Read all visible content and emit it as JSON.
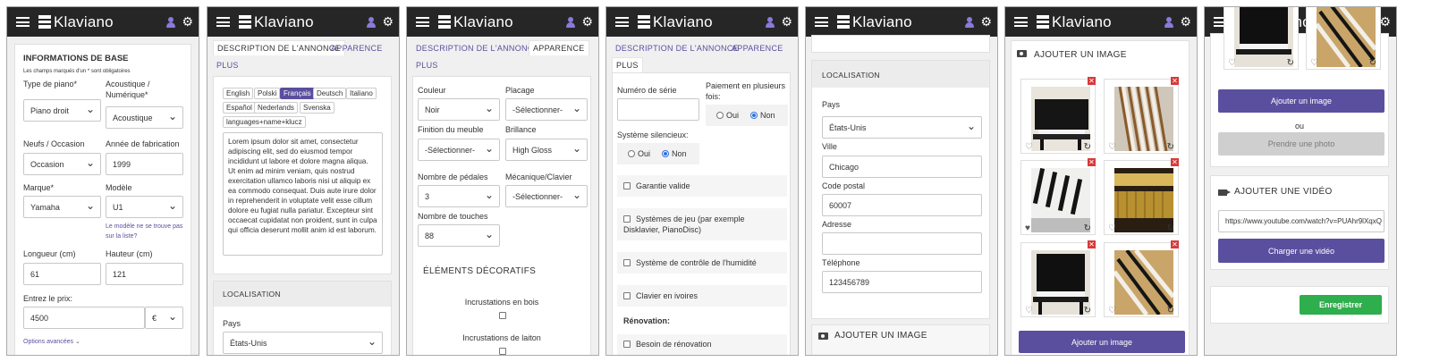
{
  "app": {
    "name": "Klaviano"
  },
  "panel1": {
    "title": "INFORMATIONS DE BASE",
    "note": "Les champs marqués d'un * sont obligatoires",
    "piano_type_label": "Type de piano*",
    "piano_type_value": "Piano droit",
    "acoustic_label": "Acoustique / Numérique*",
    "acoustic_value": "Acoustique",
    "condition_label": "Neufs / Occasion",
    "condition_value": "Occasion",
    "year_label": "Année de fabrication",
    "year_value": "1999",
    "brand_label": "Marque*",
    "brand_value": "Yamaha",
    "model_label": "Modèle",
    "model_value": "U1",
    "model_missing": "Le modèle ne se trouve pas sur la liste?",
    "length_label": "Longueur (cm)",
    "length_value": "61",
    "height_label": "Hauteur (cm)",
    "height_value": "121",
    "price_label": "Entrez le prix:",
    "price_value": "4500",
    "currency": "€",
    "advanced": "Options avancées ⌄"
  },
  "panel2": {
    "tab_description": "DESCRIPTION DE L'ANNONCE",
    "tab_appearance": "APPARENCE",
    "tab_more": "PLUS",
    "languages": [
      "English",
      "Polski",
      "Français",
      "Deutsch",
      "Italiano",
      "Español",
      "Nederlands",
      "Svenska",
      "languages+name+klucz"
    ],
    "selected_language": "Français",
    "lorem": "Lorem ipsum dolor sit amet, consectetur adipiscing elit, sed do eiusmod tempor incididunt ut labore et dolore magna aliqua. Ut enim ad minim veniam, quis nostrud exercitation ullamco laboris nisi ut aliquip ex ea commodo consequat. Duis aute irure dolor in reprehenderit in voluptate velit esse cillum dolore eu fugiat nulla pariatur. Excepteur sint occaecat cupidatat non proident, sunt in culpa qui officia deserunt mollit anim id est laborum.",
    "location_title": "LOCALISATION",
    "country_label": "Pays",
    "country_value": "États-Unis"
  },
  "panel3": {
    "tab_description": "DESCRIPTION DE L'ANNONCE",
    "tab_appearance": "APPARENCE",
    "tab_more": "PLUS",
    "color_label": "Couleur",
    "color_value": "Noir",
    "placement_label": "Placage",
    "placement_value": "-Sélectionner-",
    "finish_label": "Finition du meuble",
    "finish_value": "-Sélectionner-",
    "gloss_label": "Brillance",
    "gloss_value": "High Gloss",
    "pedals_label": "Nombre de pédales",
    "pedals_value": "3",
    "mechanics_label": "Mécanique/Clavier",
    "mechanics_value": "-Sélectionner-",
    "keys_label": "Nombre de touches",
    "keys_value": "88",
    "decor_title": "ÉLÉMENTS DÉCORATIFS",
    "inlay_wood": "Incrustations en bois",
    "inlay_brass": "Incrustations de laiton"
  },
  "panel4": {
    "tab_description": "DESCRIPTION DE L'ANNONCE",
    "tab_appearance": "APPARENCE",
    "tab_more": "PLUS",
    "serial_label": "Numéro de série",
    "installments_label": "Paiement en plusieurs fois:",
    "yes": "Oui",
    "no": "Non",
    "silent_label": "Système silencieux:",
    "warranty": "Garantie valide",
    "player_system": "Systèmes de jeu (par exemple Disklavier, PianoDisc)",
    "humidity": "Système de contrôle de l'humidité",
    "ivory": "Clavier en ivoires",
    "renovation_title": "Rénovation:",
    "needs_renovation": "Besoin de rénovation"
  },
  "panel5": {
    "location_title": "LOCALISATION",
    "country_label": "Pays",
    "country_value": "États-Unis",
    "city_label": "Ville",
    "city_value": "Chicago",
    "zip_label": "Code postal",
    "zip_value": "60007",
    "address_label": "Adresse",
    "address_value": "",
    "phone_label": "Téléphone",
    "phone_value": "123456789",
    "add_image_title": "AJOUTER UN IMAGE"
  },
  "panel6": {
    "add_image_title": "AJOUTER UN IMAGE",
    "add_image_button": "Ajouter un image"
  },
  "panel7": {
    "add_image_button": "Ajouter un image",
    "or": "ou",
    "take_photo": "Prendre une photo",
    "add_video_title": "AJOUTER UNE VIDÉO",
    "video_url": "https://www.youtube.com/watch?v=PUAhr9lXqxQ",
    "upload_video": "Charger une vidéo",
    "save": "Enregistrer"
  },
  "colors": {
    "header": "#262626",
    "accent": "#5a4f9e",
    "save": "#2fae4d",
    "remove": "#d63a3a"
  }
}
